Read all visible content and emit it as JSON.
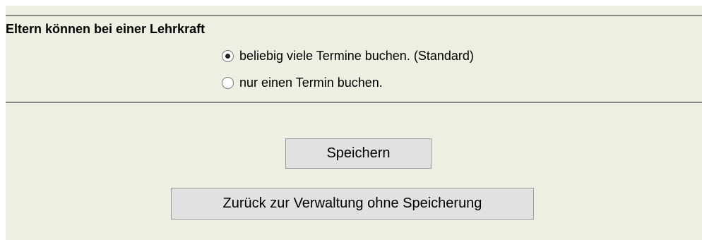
{
  "setting": {
    "heading": "Eltern können bei einer Lehrkraft",
    "options": [
      {
        "label": "beliebig viele Termine buchen. (Standard)",
        "selected": true
      },
      {
        "label": "nur einen Termin buchen.",
        "selected": false
      }
    ]
  },
  "actions": {
    "save_label": "Speichern",
    "back_label": "Zurück zur Verwaltung ohne Speicherung"
  }
}
